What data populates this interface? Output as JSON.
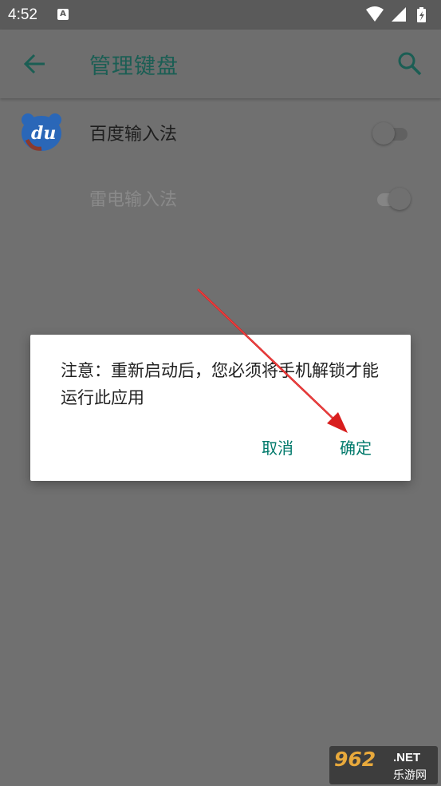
{
  "status_bar": {
    "time": "4:52",
    "notif_letter": "A"
  },
  "app_bar": {
    "title": "管理键盘"
  },
  "keyboards": [
    {
      "label": "百度输入法",
      "enabled": false,
      "disabled": false,
      "icon": "baidu-du-icon",
      "icon_text": "du"
    },
    {
      "label": "雷电输入法",
      "enabled": true,
      "disabled": true
    }
  ],
  "dialog": {
    "message": "注意：重新启动后，您必须将手机解锁才能运行此应用",
    "cancel_label": "取消",
    "ok_label": "确定"
  },
  "watermark": {
    "number": "962",
    "net": ".NET",
    "site": "乐游网"
  },
  "colors": {
    "accent": "#00796b",
    "title": "#1b5e54",
    "arrow": "#d81e1e",
    "scrim_bg": "#707070",
    "baidu_blue": "#2a67b8"
  }
}
